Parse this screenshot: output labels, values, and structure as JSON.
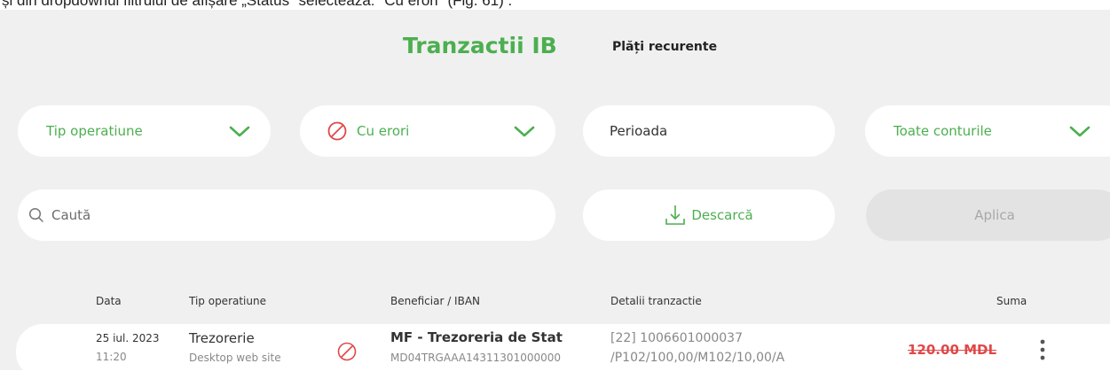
{
  "caption": "și din dropdownul filtrului de afișare „Status” selectează: \"Cu erori\" (Fig. 61) .",
  "header": {
    "title": "Tranzactii IB",
    "tab_recurring": "Plăți recurente"
  },
  "filters": {
    "operation_type": "Tip operatiune",
    "status": "Cu erori",
    "period": "Perioada",
    "accounts": "Toate conturile"
  },
  "search": {
    "placeholder": "Caută"
  },
  "actions": {
    "download": "Descarcă",
    "apply": "Aplica"
  },
  "table": {
    "columns": [
      "Data",
      "Tip operatiune",
      "Beneficiar / IBAN",
      "Detalii tranzactie",
      "Suma"
    ],
    "rows": [
      {
        "date": "25 iul. 2023",
        "time": "11:20",
        "type": "Trezorerie",
        "channel": "Desktop web site",
        "beneficiary": "MF - Trezoreria de Stat",
        "iban": "MD04TRGAAA14311301000000",
        "details_line1": "[22] 1006601000037",
        "details_line2": "/P102/100,00/M102/10,00/A",
        "amount": "120.00 MDL"
      }
    ]
  },
  "colors": {
    "accent": "#4caf50",
    "error": "#e04848",
    "panel_bg": "#f0f0f0"
  }
}
